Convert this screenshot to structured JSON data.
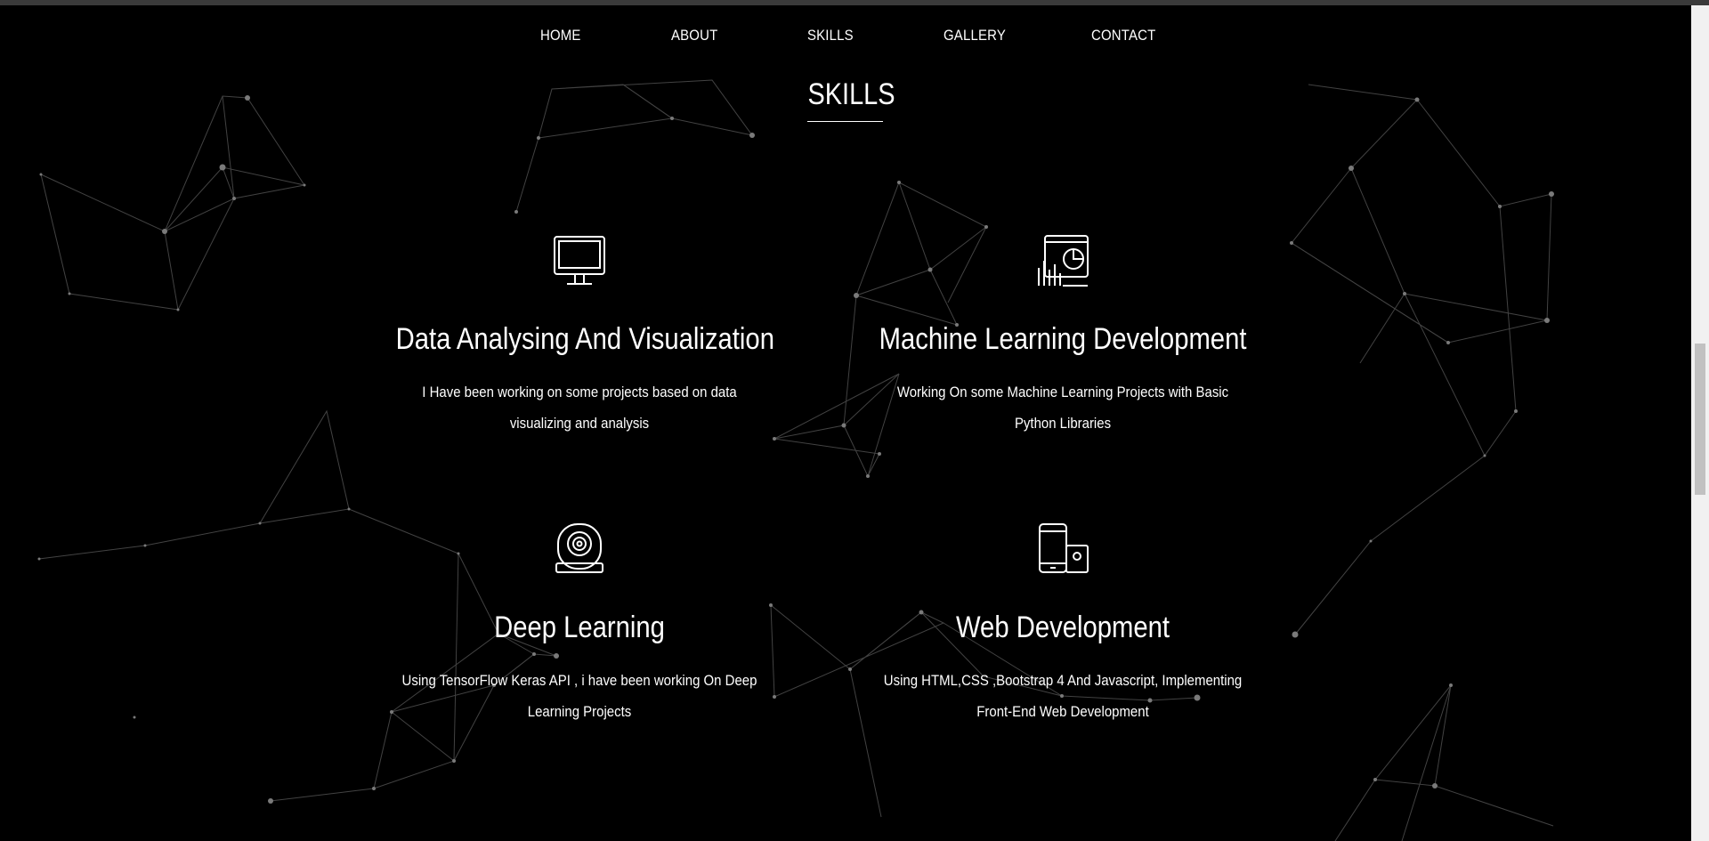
{
  "nav": {
    "items": [
      {
        "label": "HOME"
      },
      {
        "label": "ABOUT"
      },
      {
        "label": "SKILLS"
      },
      {
        "label": "GALLERY"
      },
      {
        "label": "CONTACT"
      }
    ]
  },
  "section": {
    "title": "SKILLS"
  },
  "skills": [
    {
      "icon": "monitor-icon",
      "title": "Data Analysing And Visualization",
      "description": "I Have been working on some projects based on data visualizing and analysis"
    },
    {
      "icon": "analytics-chart-icon",
      "title": "Machine Learning Development",
      "description": "Working On some Machine Learning Projects with Basic Python Libraries"
    },
    {
      "icon": "webcam-icon",
      "title": "Deep Learning",
      "description": "Using TensorFlow Keras API , i have been working On Deep Learning Projects"
    },
    {
      "icon": "devices-icon",
      "title": "Web Development",
      "description": "Using HTML,CSS ,Bootstrap 4 And Javascript, Implementing Front-End Web Development"
    }
  ],
  "colors": {
    "background": "#000000",
    "text": "#ffffff",
    "particles": "#5a5a5a"
  }
}
